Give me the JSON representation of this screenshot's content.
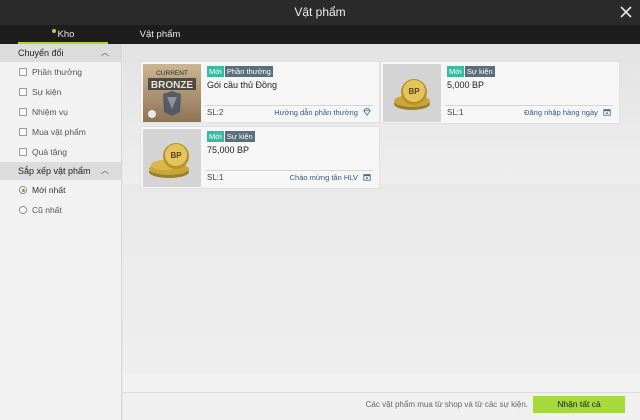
{
  "window": {
    "title": "Vật phẩm"
  },
  "tabs": [
    {
      "label": "Kho",
      "active": true
    },
    {
      "label": "Vật phẩm",
      "active": false
    }
  ],
  "sidebar": {
    "filter_section": {
      "title": "Chuyển đổi",
      "options": [
        "Phần thưởng",
        "Sự kiện",
        "Nhiệm vụ",
        "Mua vật phẩm",
        "Quà tặng"
      ]
    },
    "sort_section": {
      "title": "Sắp xếp vật phẩm",
      "options": [
        {
          "label": "Mới nhất",
          "selected": true
        },
        {
          "label": "Cũ nhất",
          "selected": false
        }
      ]
    }
  },
  "items": [
    {
      "tag_new": "Mới",
      "tag_type": "Phần thưởng",
      "name": "Gói cầu thủ Đồng",
      "quantity": "SL:2",
      "source": "Hướng dẫn phần thưởng",
      "thumbnail": {
        "label_top": "CURRENT",
        "label_main": "BRONZE"
      },
      "source_icon": "diamond-icon"
    },
    {
      "tag_new": "Mới",
      "tag_type": "Sự kiện",
      "name": "5,000 BP",
      "quantity": "SL:1",
      "source": "Đăng nhập hàng ngày",
      "thumbnail": {
        "label": "BP"
      },
      "source_icon": "calendar-icon"
    },
    {
      "tag_new": "Mới",
      "tag_type": "Sự kiện",
      "name": "75,000 BP",
      "quantity": "SL:1",
      "source": "Chào mừng tân HLV",
      "thumbnail": {
        "label": "BP"
      },
      "source_icon": "calendar-icon"
    }
  ],
  "footer": {
    "note": "Các vật phẩm mua từ shop và từ các sự kiện.",
    "claim_all_label": "Nhận tất cả"
  },
  "colors": {
    "accent": "#a6d93a",
    "tag_new": "#3bb8a0",
    "tag_type": "#5b6f7a",
    "titlebar": "#2b2b2b"
  }
}
